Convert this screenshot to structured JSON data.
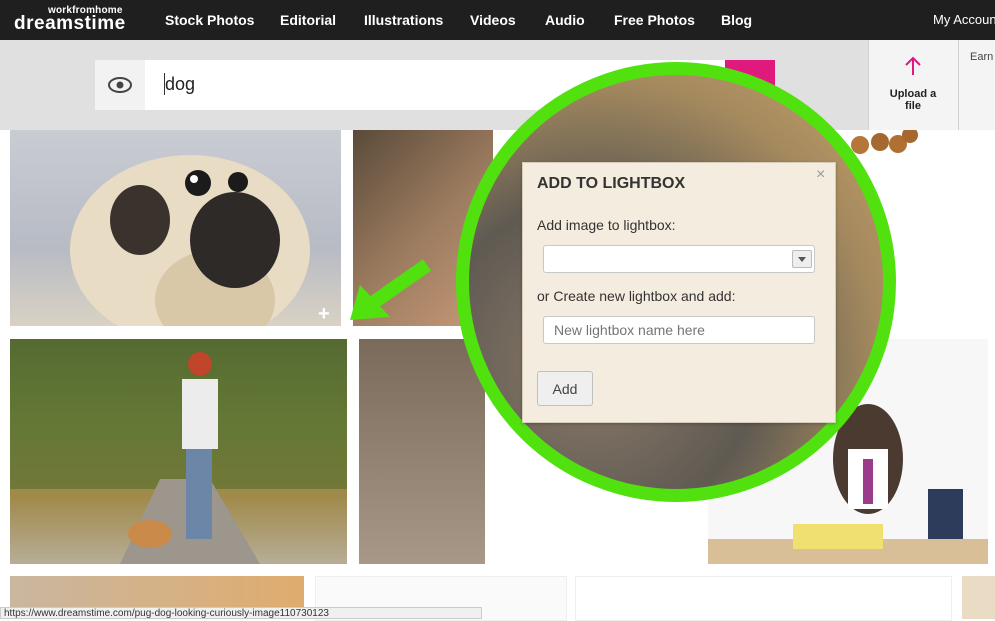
{
  "brand": {
    "tagline": "workfromhome",
    "name": "dreamstime"
  },
  "nav": {
    "items": [
      "Stock Photos",
      "Editorial",
      "Illustrations",
      "Videos",
      "Audio",
      "Free Photos",
      "Blog"
    ],
    "account": "My Account"
  },
  "search": {
    "query": "dog"
  },
  "upload": {
    "label": "Upload a file"
  },
  "earn": {
    "label": "Earn"
  },
  "lightbox": {
    "title": "ADD TO LIGHTBOX",
    "add_to_existing_label": "Add image to lightbox:",
    "create_new_label": "or Create new lightbox and add:",
    "new_name_placeholder": "New lightbox name here",
    "add_button": "Add",
    "close_glyph": "×"
  },
  "status_bar": {
    "url": "https://www.dreamstime.com/pug-dog-looking-curiously-image110730123"
  },
  "colors": {
    "accent_pink": "#e0197d",
    "highlight_green": "#50e10f",
    "nav_bg": "#1f1f1f"
  }
}
